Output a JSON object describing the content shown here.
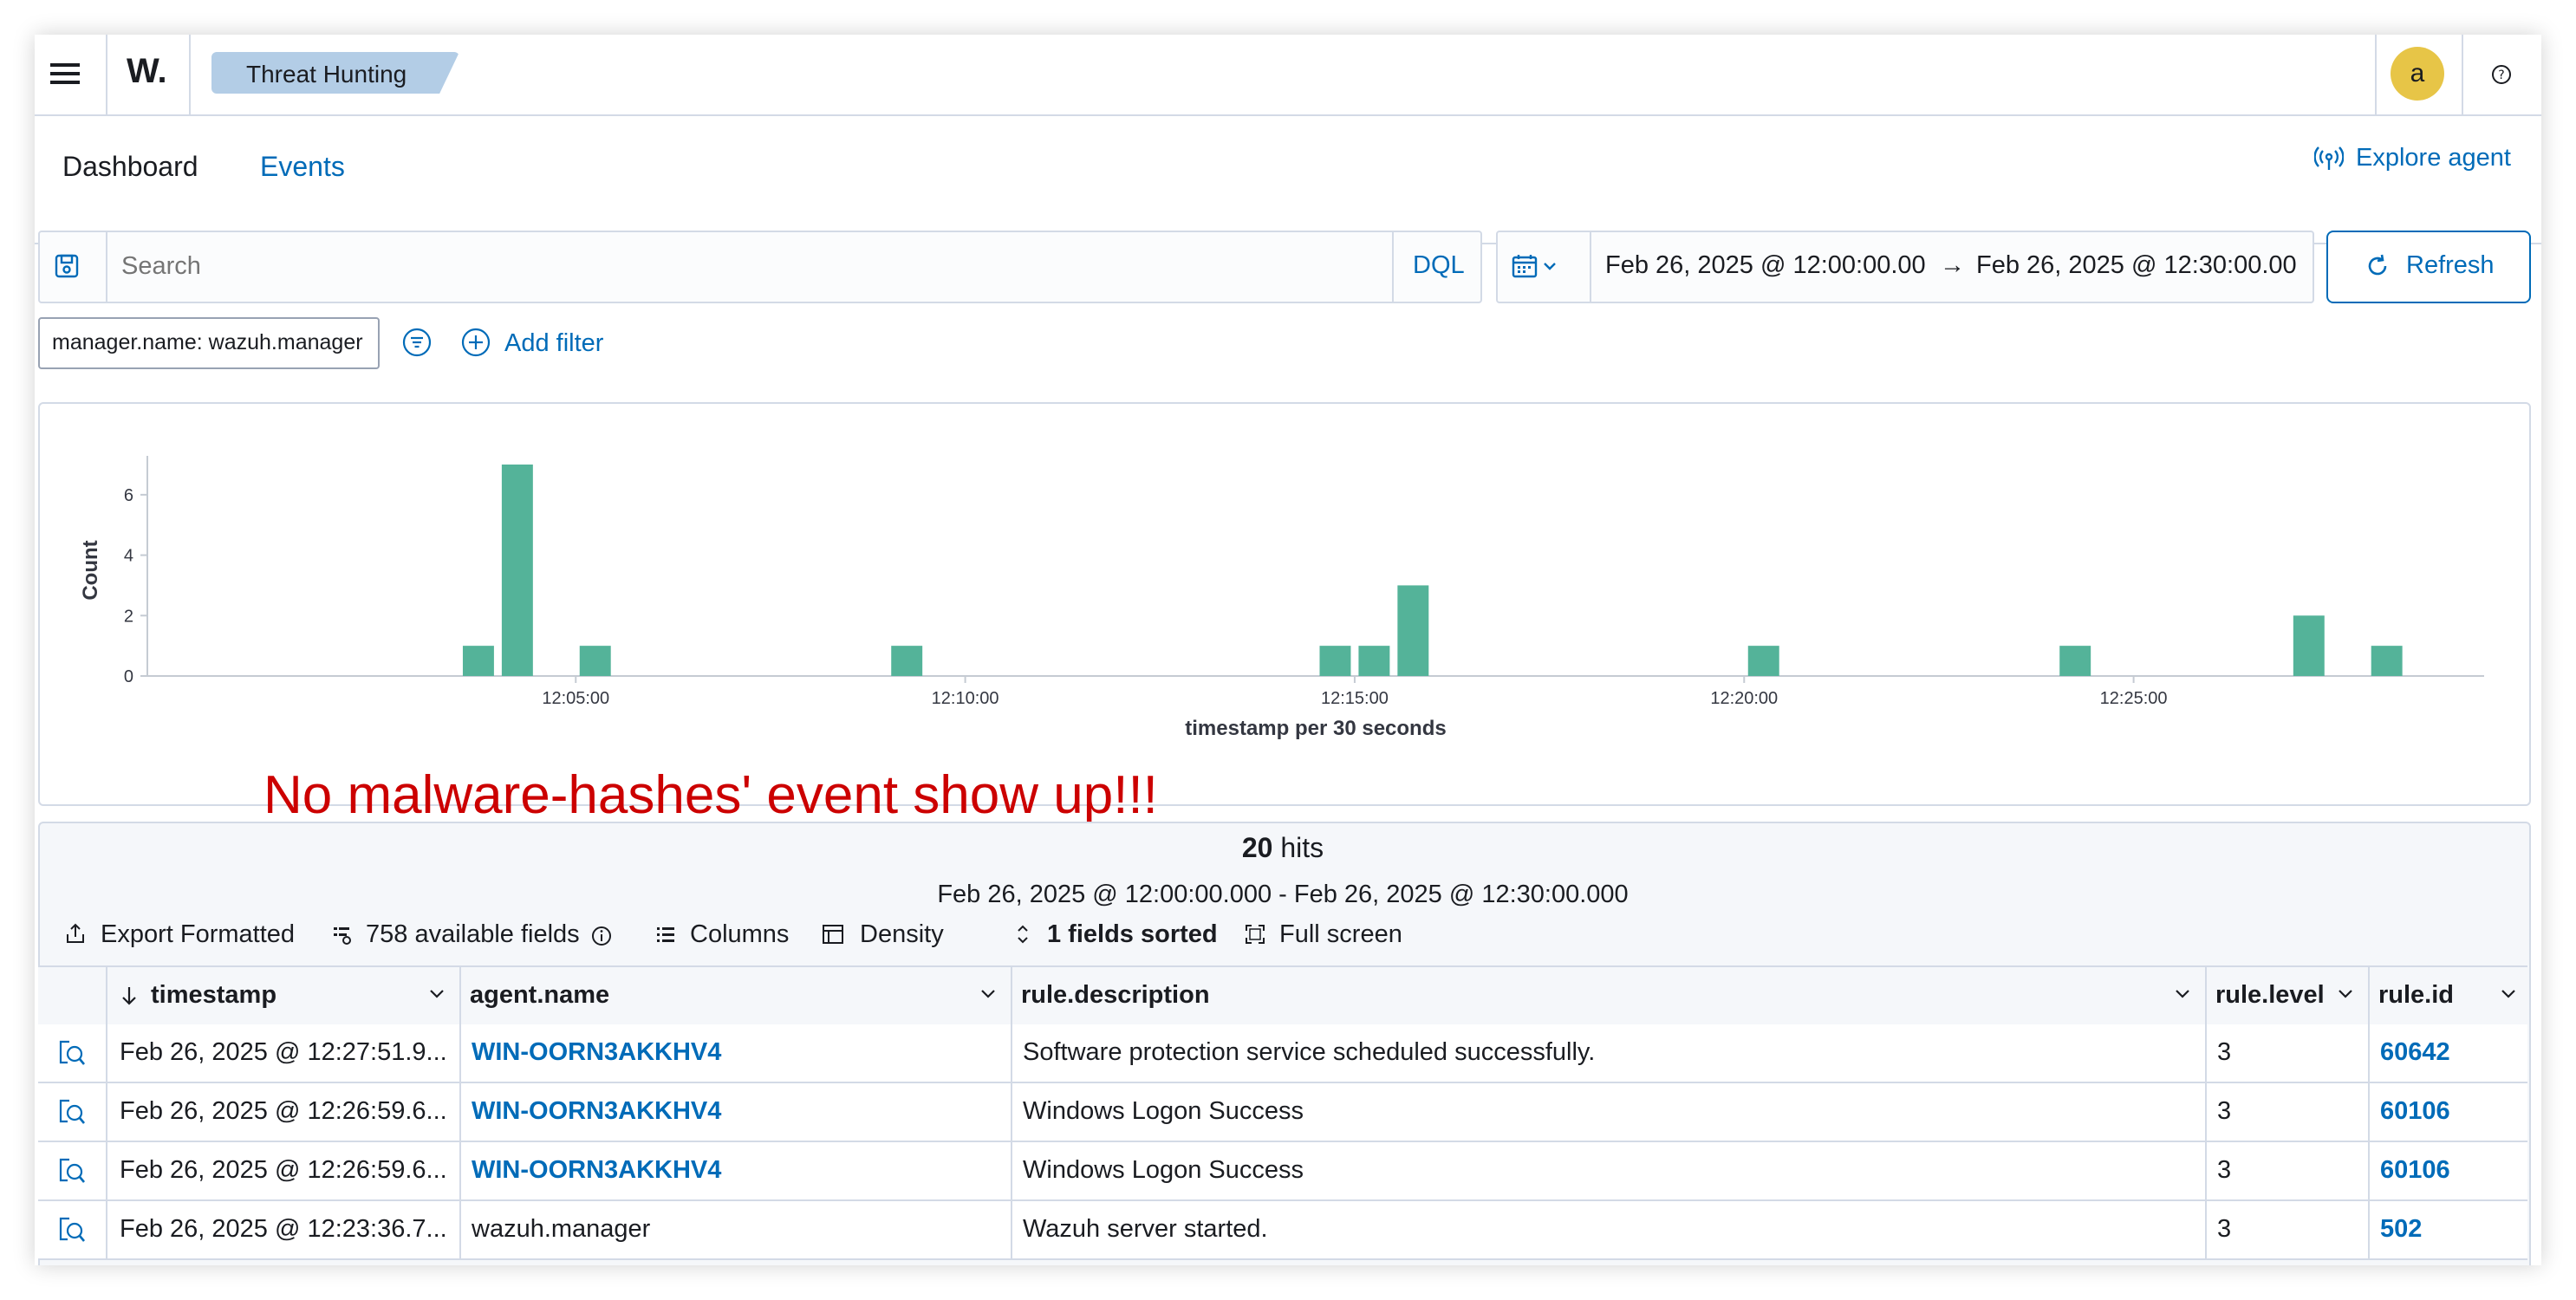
{
  "header": {
    "logo_text": "W.",
    "breadcrumb": "Threat Hunting",
    "avatar_letter": "a"
  },
  "tabs": [
    {
      "label": "Dashboard",
      "active": false
    },
    {
      "label": "Events",
      "active": true
    }
  ],
  "explore_agent_label": "Explore agent",
  "search": {
    "placeholder": "Search",
    "language": "DQL"
  },
  "date_picker": {
    "start": "Feb 26, 2025 @ 12:00:00.00",
    "arrow": "→",
    "end": "Feb 26, 2025 @ 12:30:00.00"
  },
  "refresh_label": "Refresh",
  "filter": {
    "pill": "manager.name: wazuh.manager",
    "add_label": "Add filter"
  },
  "annotation_text": "No malware-hashes' event show up!!!",
  "colors": {
    "accent": "#006bb8",
    "bar": "#54b399",
    "annotation": "#cc0000",
    "breadcrumb_bg": "#b3cde6",
    "avatar": "#e7c547"
  },
  "chart_data": {
    "type": "bar",
    "ylabel": "Count",
    "xlabel": "timestamp per 30 seconds",
    "ylim": [
      0,
      7
    ],
    "y_ticks": [
      "0",
      "2",
      "4",
      "6"
    ],
    "x_ticks": [
      "12:05:00",
      "12:10:00",
      "12:15:00",
      "12:20:00",
      "12:25:00"
    ],
    "x": [
      "12:03:30",
      "12:04:00",
      "12:05:00",
      "12:09:00",
      "12:14:30",
      "12:15:00",
      "12:15:30",
      "12:20:00",
      "12:24:00",
      "12:27:00",
      "12:28:00"
    ],
    "values": [
      1,
      7,
      1,
      1,
      1,
      1,
      3,
      1,
      1,
      2,
      1
    ]
  },
  "results": {
    "hits_count": "20",
    "hits_label": "hits",
    "range": "Feb 26, 2025 @ 12:00:00.000 - Feb 26, 2025 @ 12:30:00.000",
    "toolbar": {
      "export": "Export Formatted",
      "fields": "758 available fields",
      "columns": "Columns",
      "density": "Density",
      "sorted": "1 fields sorted",
      "fullscreen": "Full screen"
    },
    "columns": [
      "timestamp",
      "agent.name",
      "rule.description",
      "rule.level",
      "rule.id"
    ],
    "rows": [
      {
        "timestamp": "Feb 26, 2025 @ 12:27:51.9...",
        "agent": "WIN-OORN3AKKHV4",
        "description": "Software protection service scheduled successfully.",
        "level": "3",
        "id": "60642"
      },
      {
        "timestamp": "Feb 26, 2025 @ 12:26:59.6...",
        "agent": "WIN-OORN3AKKHV4",
        "description": "Windows Logon Success",
        "level": "3",
        "id": "60106"
      },
      {
        "timestamp": "Feb 26, 2025 @ 12:26:59.6...",
        "agent": "WIN-OORN3AKKHV4",
        "description": "Windows Logon Success",
        "level": "3",
        "id": "60106"
      },
      {
        "timestamp": "Feb 26, 2025 @ 12:23:36.7...",
        "agent": "wazuh.manager",
        "description": "Wazuh server started.",
        "level": "3",
        "id": "502"
      }
    ]
  }
}
